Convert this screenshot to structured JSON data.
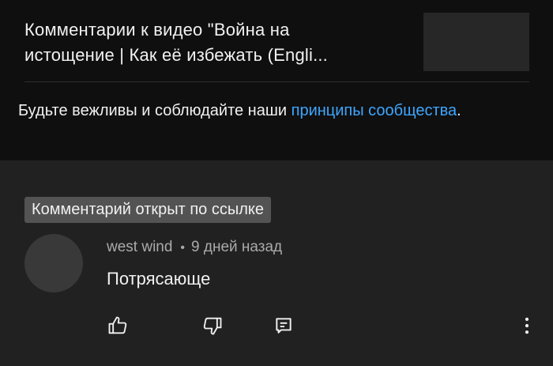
{
  "header": {
    "title_line1": "Комментарии к видео \"Война на",
    "title_line2": "истощение | Как её избежать (Engli..."
  },
  "guidelines": {
    "text": "Будьте вежливы и соблюдайте наши ",
    "link": "принципы сообщества",
    "suffix": "."
  },
  "comment": {
    "badge": "Комментарий открыт по ссылке",
    "author": "west wind",
    "separator": "•",
    "time": "9 дней назад",
    "text": "Потрясающе"
  },
  "actions": {
    "like_icon": "thumb-up-icon",
    "dislike_icon": "thumb-down-icon",
    "reply_icon": "reply-icon",
    "more_icon": "more-vertical-icon"
  },
  "colors": {
    "header_bg": "#0f0f0f",
    "body_bg": "#212121",
    "link": "#3ea6ff",
    "badge_bg": "#535353"
  }
}
